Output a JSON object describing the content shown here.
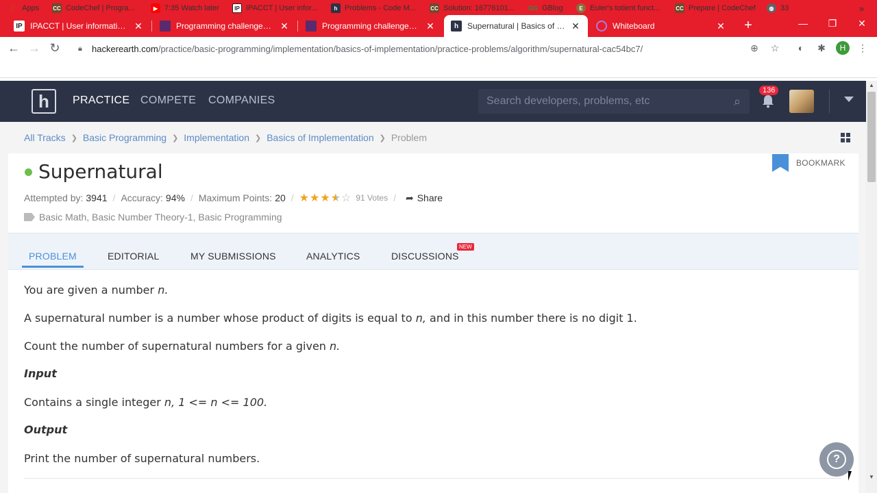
{
  "browser": {
    "tabs": [
      {
        "title": "IPACCT | User information port",
        "favicon": "IP"
      },
      {
        "title": "Programming challenges, codi",
        "favicon": ""
      },
      {
        "title": "Programming challenges, codi",
        "favicon": ""
      },
      {
        "title": "Supernatural | Basics of Implem",
        "favicon": "h"
      },
      {
        "title": "Whiteboard",
        "favicon": ""
      }
    ],
    "url_domain": "hackerearth.com",
    "url_path": "/practice/basic-programming/implementation/basics-of-implementation/practice-problems/algorithm/supernatural-cac54bc7/",
    "profile_initial": "H",
    "bookmarks": [
      {
        "label": "Apps",
        "icon": "apps-grid-icon",
        "color": "#d93025"
      },
      {
        "label": "CodeChef | Progra...",
        "icon": "codechef-icon",
        "color": "#6d4c2c"
      },
      {
        "label": "7:35 Watch later",
        "icon": "youtube-icon",
        "color": "#ff0000"
      },
      {
        "label": "IPACCT | User infor...",
        "icon": "ipacct-icon",
        "color": "#222"
      },
      {
        "label": "Problems - Code M...",
        "icon": "hackerearth-icon",
        "color": "#2d3346"
      },
      {
        "label": "Solution: 16776101...",
        "icon": "codechef-icon",
        "color": "#6d4c2c"
      },
      {
        "label": "GBlog",
        "icon": "gfg-icon",
        "color": "#2f8d46"
      },
      {
        "label": "Euler's totient funct...",
        "icon": "euler-icon",
        "color": "#8a6d3b"
      },
      {
        "label": "Prepare | CodeChef",
        "icon": "codechef-icon",
        "color": "#6d4c2c"
      },
      {
        "label": "33",
        "icon": "globe-icon",
        "color": "#5f6368"
      }
    ]
  },
  "header": {
    "logo": "h",
    "nav": [
      "PRACTICE",
      "COMPETE",
      "COMPANIES"
    ],
    "search_placeholder": "Search developers, problems, etc",
    "notification_count": "136"
  },
  "breadcrumb": [
    "All Tracks",
    "Basic Programming",
    "Implementation",
    "Basics of Implementation",
    "Problem"
  ],
  "problem": {
    "title": "Supernatural",
    "bookmark_label": "BOOKMARK",
    "attempted_label": "Attempted by:",
    "attempted_value": "3941",
    "accuracy_label": "Accuracy:",
    "accuracy_value": "94%",
    "max_points_label": "Maximum Points:",
    "max_points_value": "20",
    "rating": 3.5,
    "votes": "91 Votes",
    "share_label": "Share",
    "tags": "Basic Math, Basic Number Theory-1, Basic Programming"
  },
  "tabs": [
    {
      "label": "PROBLEM"
    },
    {
      "label": "EDITORIAL"
    },
    {
      "label": "MY SUBMISSIONS"
    },
    {
      "label": "ANALYTICS"
    },
    {
      "label": "DISCUSSIONS"
    }
  ],
  "new_badge": "NEW",
  "statement": {
    "p1_a": "You are given a number ",
    "p1_n": "n.",
    "p2_a": "A supernatural number is a number whose product of digits is equal to ",
    "p2_n": "n,",
    "p2_b": " and in this number there is no digit 1.",
    "p3_a": "Count the number of supernatural numbers for a given ",
    "p3_n": "n.",
    "input_head": "Input",
    "input_a": "Contains a single integer ",
    "input_n": "n, 1 <= n <= 100.",
    "output_head": "Output",
    "output_text": "Print the number of supernatural numbers."
  },
  "help_symbol": "?"
}
